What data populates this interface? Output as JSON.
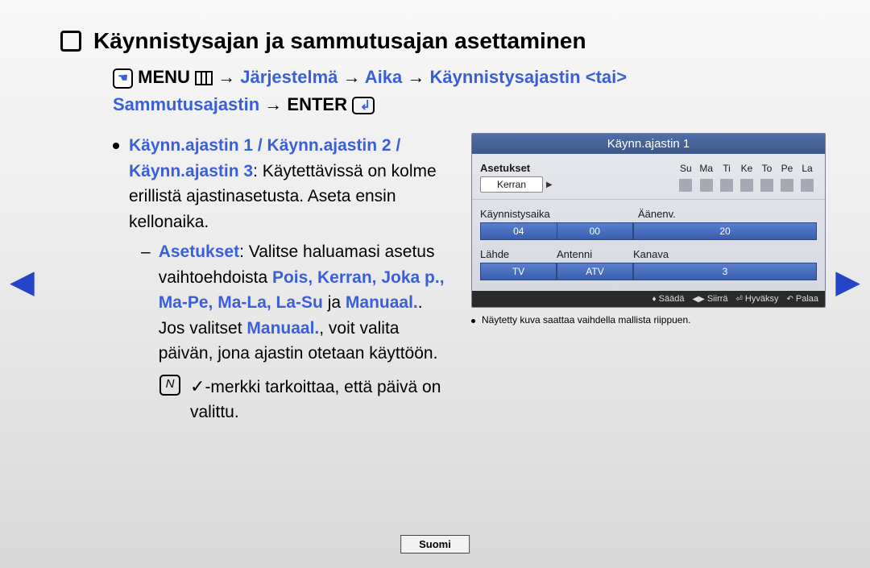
{
  "heading": "Käynnistysajan ja sammutusajan asettaminen",
  "breadcrumb": {
    "menu": "MENU",
    "path1": "Järjestelmä",
    "path2": "Aika",
    "path3": "Käynnistysajastin <tai>",
    "path4": "Sammutusajastin",
    "enter": "ENTER"
  },
  "left": {
    "timers_label": "Käynn.ajastin 1 / Käynn.ajastin 2 / Käynn.ajastin 3",
    "timers_desc": ": Käytettävissä on kolme erillistä ajastinasetusta. Aseta ensin kellonaika.",
    "settings_label": "Asetukset",
    "settings_desc1": ": Valitse haluamasi asetus vaihtoehdoista ",
    "options": "Pois, Kerran, Joka p., Ma-Pe, Ma-La, La-Su",
    "and": " ja ",
    "manual": "Manuaal.",
    "settings_desc2": ". Jos valitset ",
    "settings_desc3": ", voit valita päivän, jona ajastin otetaan käyttöön.",
    "note_check": "c",
    "note_text": "-merkki tarkoittaa, että päivä on valittu."
  },
  "panel": {
    "title": "Käynn.ajastin 1",
    "settings_label": "Asetukset",
    "settings_value": "Kerran",
    "days": [
      "Su",
      "Ma",
      "Ti",
      "Ke",
      "To",
      "Pe",
      "La"
    ],
    "start_label": "Käynnistysaika",
    "start_h": "04",
    "start_m": "00",
    "vol_label": "Äänenv.",
    "vol_val": "20",
    "source_label": "Lähde",
    "source_val": "TV",
    "antenna_label": "Antenni",
    "antenna_val": "ATV",
    "channel_label": "Kanava",
    "channel_val": "3",
    "footer": {
      "adjust": "Säädä",
      "move": "Siirrä",
      "accept": "Hyväksy",
      "back": "Palaa"
    },
    "caption": "Näytetty kuva saattaa vaihdella mallista riippuen."
  },
  "language": "Suomi"
}
